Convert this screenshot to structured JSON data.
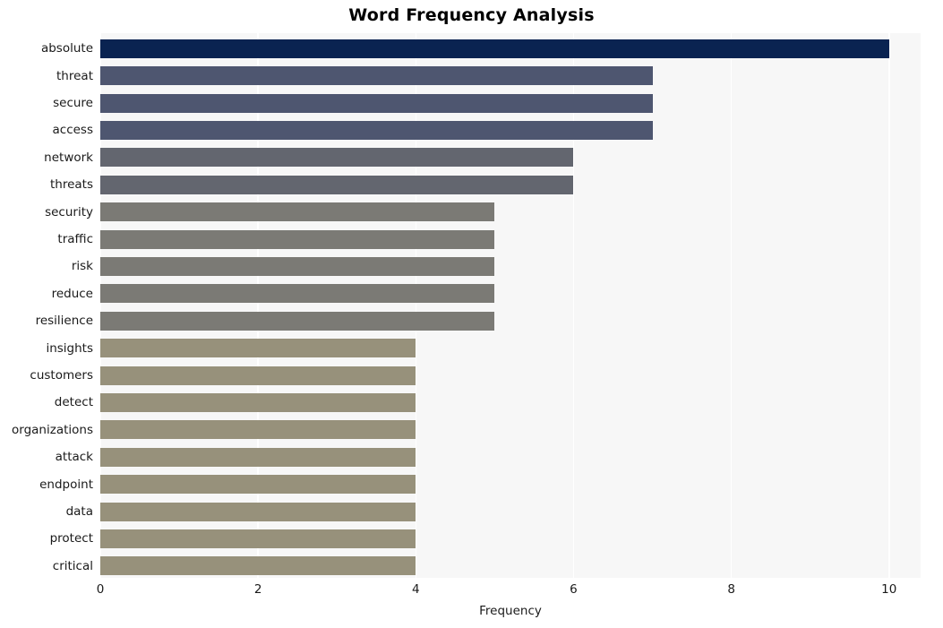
{
  "chart_data": {
    "type": "bar",
    "orientation": "horizontal",
    "title": "Word Frequency Analysis",
    "xlabel": "Frequency",
    "ylabel": "",
    "categories": [
      "absolute",
      "threat",
      "secure",
      "access",
      "network",
      "threats",
      "security",
      "traffic",
      "risk",
      "reduce",
      "resilience",
      "insights",
      "customers",
      "detect",
      "organizations",
      "attack",
      "endpoint",
      "data",
      "protect",
      "critical"
    ],
    "values": [
      10,
      7,
      7,
      7,
      6,
      6,
      5,
      5,
      5,
      5,
      5,
      4,
      4,
      4,
      4,
      4,
      4,
      4,
      4,
      4
    ],
    "bar_colors": [
      "#0a2351",
      "#4e5670",
      "#4e5670",
      "#4e5670",
      "#63666f",
      "#63666f",
      "#7b7a75",
      "#7b7a75",
      "#7b7a75",
      "#7b7a75",
      "#7b7a75",
      "#97917b",
      "#97917b",
      "#97917b",
      "#97917b",
      "#97917b",
      "#97917b",
      "#97917b",
      "#97917b",
      "#97917b"
    ],
    "xlim": [
      0,
      10.4
    ],
    "xticks": [
      0,
      2,
      4,
      6,
      8,
      10
    ],
    "xtick_labels": [
      "0",
      "2",
      "4",
      "6",
      "8",
      "10"
    ],
    "grid": "vertical-only",
    "legend": "none",
    "plot_background": "#f7f7f7",
    "gridline_color": "#ffffff",
    "figure_background": "#ffffff"
  }
}
